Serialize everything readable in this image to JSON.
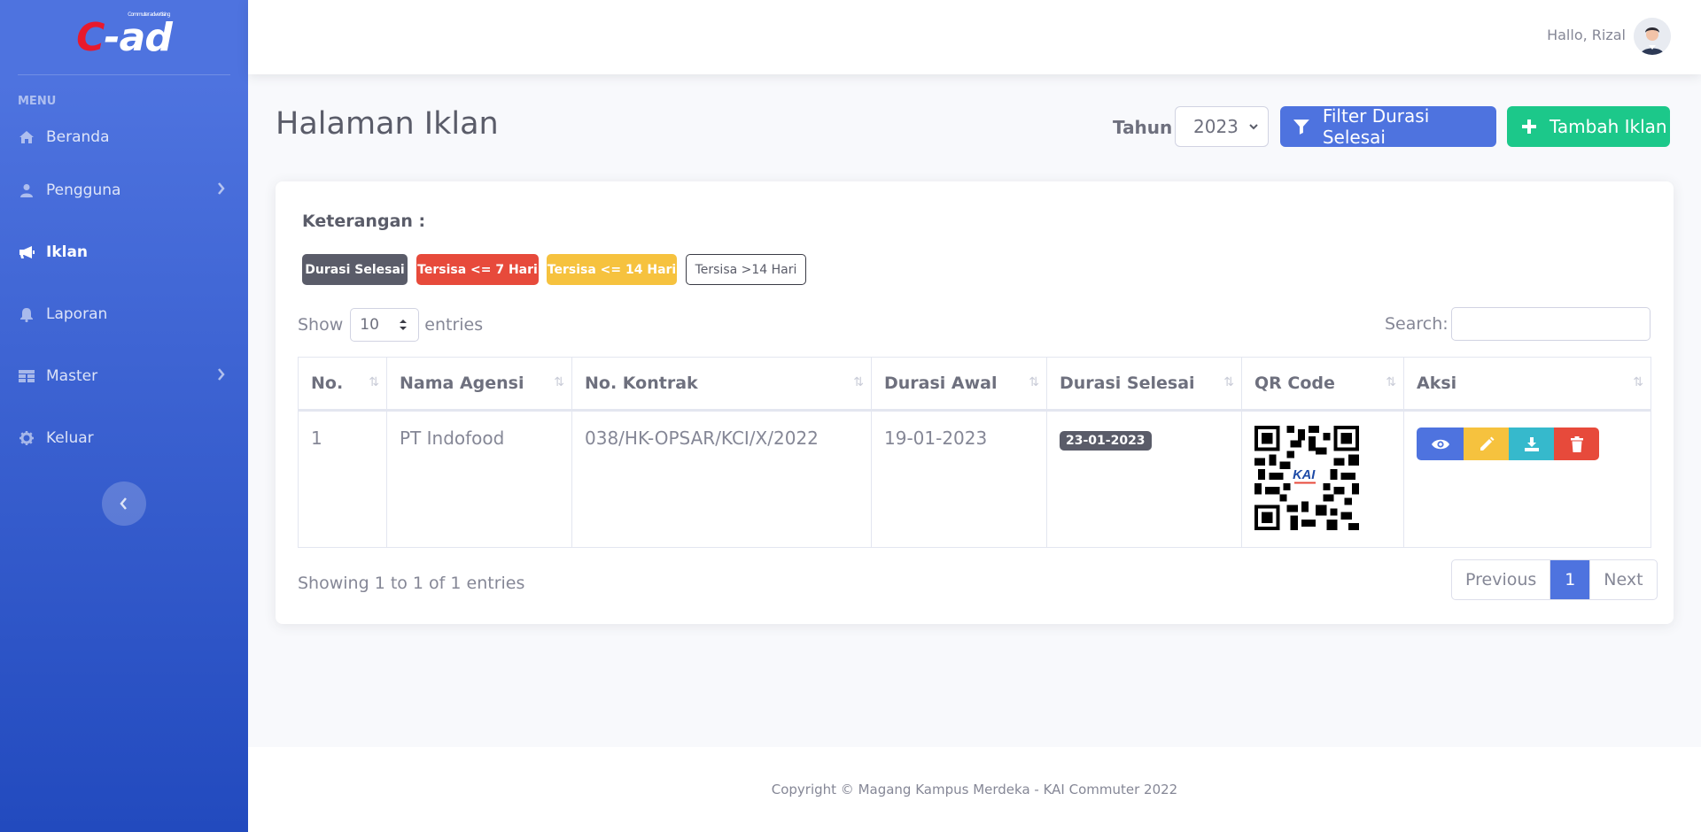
{
  "brand": {
    "logo_c": "C",
    "logo_rest": "-ad",
    "tagline": "Commuter advertising"
  },
  "sidebar": {
    "heading": "MENU",
    "items": [
      {
        "label": "Beranda",
        "icon": "home-icon"
      },
      {
        "label": "Pengguna",
        "icon": "user-icon"
      },
      {
        "label": "Iklan",
        "icon": "bullhorn-icon"
      },
      {
        "label": "Laporan",
        "icon": "bell-icon"
      },
      {
        "label": "Master",
        "icon": "table-icon"
      },
      {
        "label": "Keluar",
        "icon": "gear-icon"
      }
    ]
  },
  "topbar": {
    "greeting": "Hallo, Rizal"
  },
  "page": {
    "title": "Halaman Iklan",
    "year_label": "Tahun",
    "year_value": "2023",
    "filter_button": "Filter Durasi Selesai",
    "add_button": "Tambah Iklan"
  },
  "legend": {
    "label": "Keterangan :",
    "badges": [
      "Durasi Selesai",
      "Tersisa <= 7 Hari",
      "Tersisa <= 14 Hari",
      "Tersisa >14 Hari"
    ]
  },
  "datatable": {
    "show_label": "Show",
    "length_value": "10",
    "entries_label": "entries",
    "search_label": "Search:",
    "columns": [
      "No.",
      "Nama Agensi",
      "No. Kontrak",
      "Durasi Awal",
      "Durasi Selesai",
      "QR Code",
      "Aksi"
    ],
    "rows": [
      {
        "no": "1",
        "agensi": "PT Indofood",
        "kontrak": "038/HK-OPSAR/KCI/X/2022",
        "awal": "19-01-2023",
        "selesai": "23-01-2023",
        "qr_logo": "KAI"
      }
    ],
    "info": "Showing 1 to 1 of 1 entries",
    "pagination": {
      "previous": "Previous",
      "current": "1",
      "next": "Next"
    }
  },
  "footer": {
    "copyright": "Copyright © Magang Kampus Merdeka - KAI Commuter 2022"
  },
  "colors": {
    "primary": "#4e73df",
    "success": "#1cc88a",
    "warning": "#f6c23e",
    "danger": "#e74a3b",
    "info": "#36b9cc",
    "dark": "#5a5c69"
  }
}
